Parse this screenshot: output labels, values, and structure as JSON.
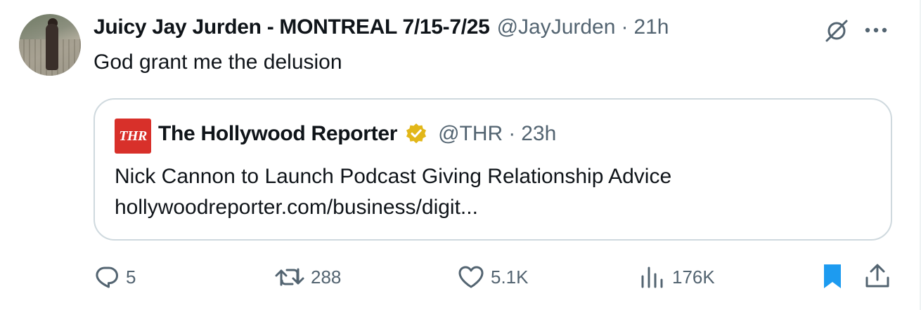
{
  "tweet": {
    "author_name": "Juicy Jay Jurden - MONTREAL 7/15-7/25",
    "author_handle": "@JayJurden",
    "separator": "·",
    "time": "21h",
    "text": "God grant me the delusion"
  },
  "quoted_tweet": {
    "logo_text": "THR",
    "author_name": "The Hollywood Reporter",
    "verified": "gold",
    "author_handle": "@THR",
    "separator": "·",
    "time": "23h",
    "text_line1": "Nick Cannon to Launch Podcast Giving Relationship Advice",
    "text_line2": "hollywoodreporter.com/business/digit..."
  },
  "actions": {
    "replies": "5",
    "reposts": "288",
    "likes": "5.1K",
    "views": "176K",
    "bookmarked": true
  },
  "icons": {
    "header_right": [
      "grok-icon",
      "more-icon"
    ],
    "action_bar": [
      "reply-icon",
      "repost-icon",
      "like-icon",
      "views-icon",
      "bookmark-icon",
      "share-icon"
    ]
  },
  "colors": {
    "text": "#0f1419",
    "secondary": "#536471",
    "border": "#cfd9de",
    "accent_blue": "#1d9bf0",
    "thr_red": "#d8302a",
    "verified_gold": "#e2b719"
  }
}
